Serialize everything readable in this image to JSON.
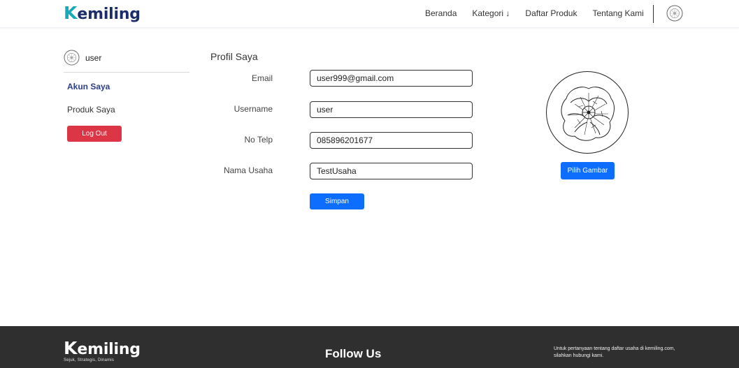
{
  "brand": {
    "logo_k": "K",
    "logo_rest": "emiling"
  },
  "nav": {
    "items": [
      {
        "label": "Beranda"
      },
      {
        "label": "Kategori ↓"
      },
      {
        "label": "Daftar Produk"
      },
      {
        "label": "Tentang Kami"
      }
    ]
  },
  "sidebar": {
    "username": "user",
    "menu": [
      {
        "label": "Akun Saya"
      },
      {
        "label": "Produk Saya"
      }
    ],
    "logout_label": "Log Out"
  },
  "profile": {
    "title": "Profil Saya",
    "fields": [
      {
        "label": "Email",
        "value": "user999@gmail.com"
      },
      {
        "label": "Username",
        "value": "user"
      },
      {
        "label": "No Telp",
        "value": "085896201677"
      },
      {
        "label": "Nama Usaha",
        "value": "TestUsaha"
      }
    ],
    "save_label": "Simpan",
    "choose_image_label": "Pilih Gambar"
  },
  "footer": {
    "logo_k": "K",
    "logo_rest": "emiling",
    "tagline": "Sejuk, Strategis, Dinamis",
    "follow_label": "Follow Us",
    "info_text": "Untuk pertanyaan tentang daftar usaha di kemiling.com, silahkan hubungi kami."
  },
  "colors": {
    "brand_teal": "#17a9b8",
    "brand_navy": "#1b2d6b",
    "primary": "#0d6efd",
    "danger": "#dc3545",
    "footer_bg": "#2f2f2f"
  },
  "icons": {
    "nav_avatar": "flower-avatar-icon",
    "sidebar_avatar": "flower-avatar-icon",
    "profile_photo": "poppy-flower-drawing"
  }
}
